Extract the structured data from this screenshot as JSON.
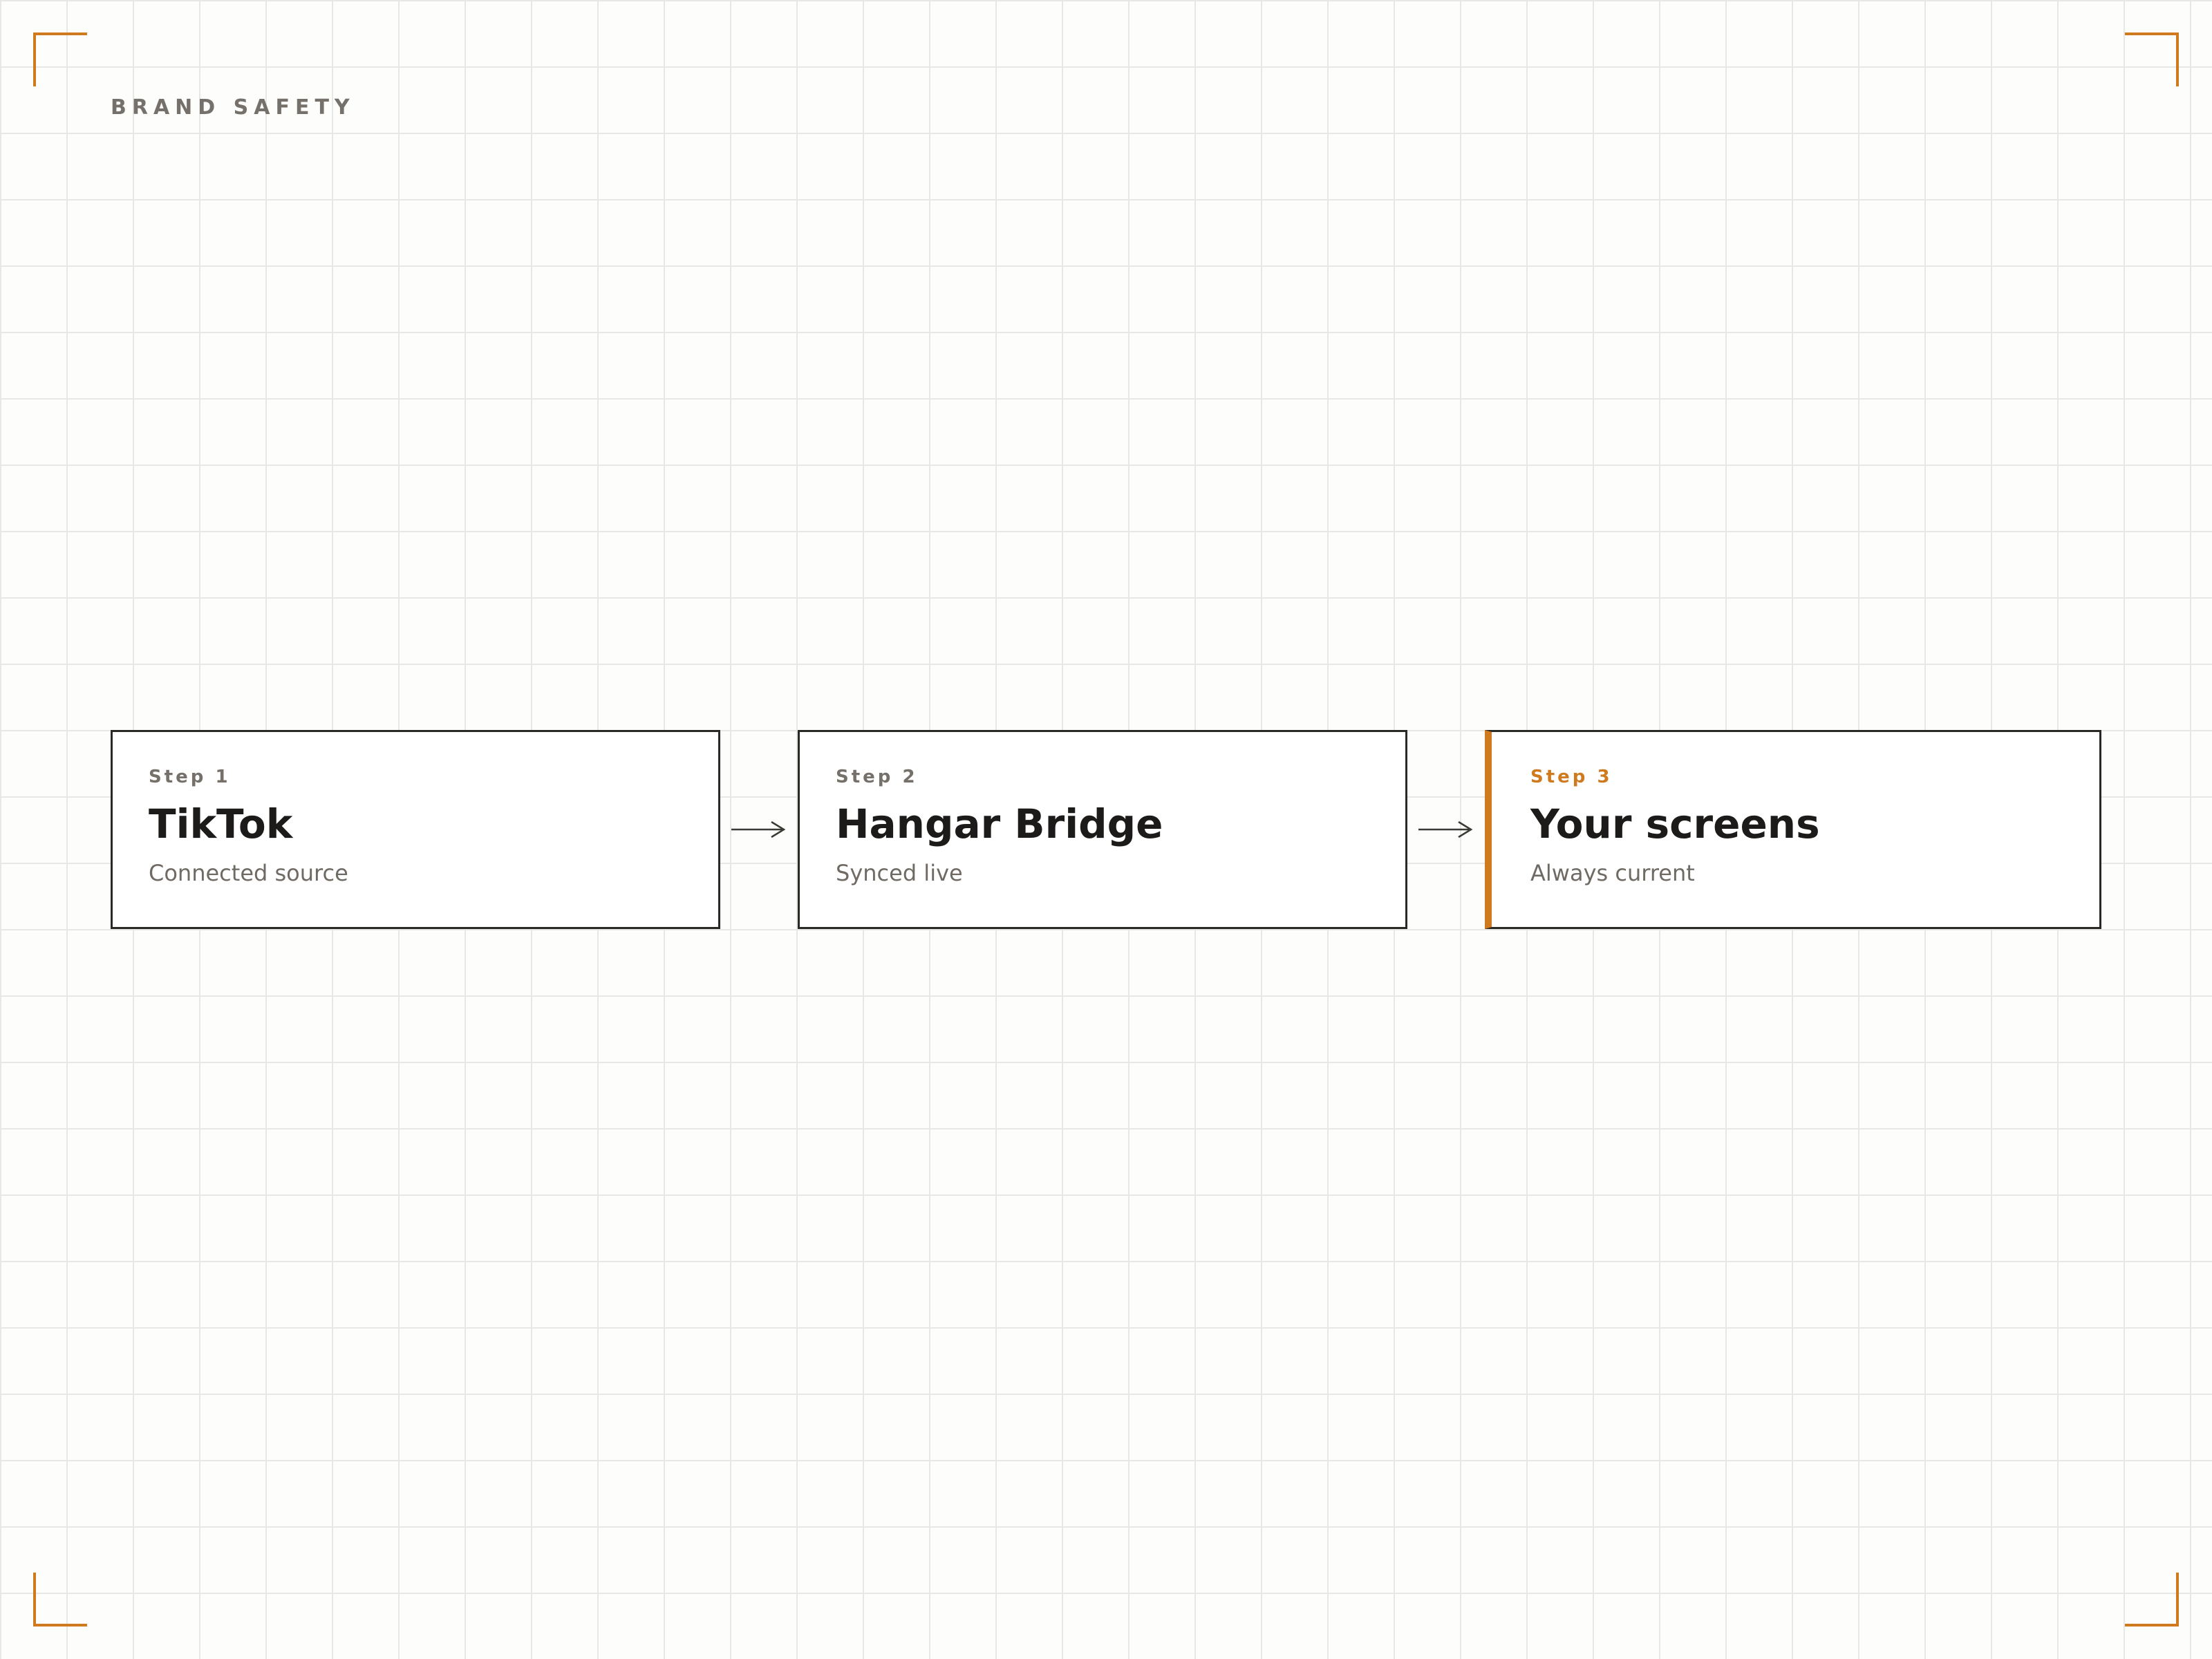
{
  "header": {
    "label": "BRAND SAFETY"
  },
  "accent_color": "#d07a1f",
  "steps": [
    {
      "number": "Step 1",
      "title": "TikTok",
      "subtitle": "Connected source"
    },
    {
      "number": "Step 2",
      "title": "Hangar Bridge",
      "subtitle": "Synced live"
    },
    {
      "number": "Step 3",
      "title": "Your screens",
      "subtitle": "Always current",
      "highlighted": true
    }
  ],
  "icons": {
    "connector": "arrow-right-icon",
    "frame": "corner-bracket-icon"
  }
}
